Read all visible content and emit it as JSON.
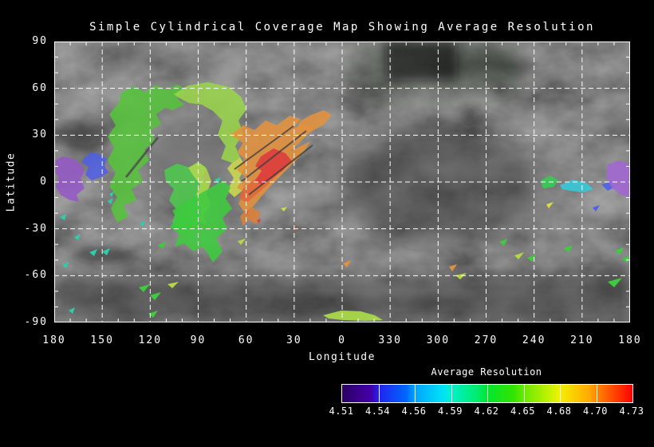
{
  "title": "Simple Cylindrical Coverage Map Showing Average Resolution",
  "map": {
    "x_axis": {
      "label": "Longitude",
      "ticks": [
        "180",
        "150",
        "120",
        "90",
        "60",
        "30",
        "0",
        "330",
        "300",
        "270",
        "240",
        "210",
        "180"
      ]
    },
    "y_axis": {
      "label": "Latitude",
      "ticks": [
        "90",
        "60",
        "30",
        "0",
        "-30",
        "-60",
        "-90"
      ]
    },
    "grid_color": "#ffffff",
    "overlays": [
      {
        "n": "purple-west",
        "c": "#9558c8",
        "o": 0.85,
        "p": "0,150 10,144 22,146 32,152 38,162 33,172 38,184 28,192 31,201 18,198 8,192 2,182 6,170 0,164"
      },
      {
        "n": "blue-west",
        "c": "#4f5fe8",
        "o": 0.85,
        "p": "37,146 46,139 57,141 66,147 63,156 68,164 58,170 47,174 39,167 43,157 35,152"
      },
      {
        "n": "green-band-west",
        "c": "#56c33c",
        "o": 0.88,
        "p": "84,64 100,56 113,63 127,55 141,60 155,54 165,61 154,71 163,79 148,86 139,83 128,91 134,103 121,111 127,125 113,135 119,149 105,161 111,175 97,185 103,199 87,205 93,219 79,227 71,209 79,195 69,181 77,165 67,149 75,133 67,119 77,105 69,91 81,77"
      },
      {
        "n": "green-lobe-lower",
        "c": "#4ec94e",
        "o": 0.88,
        "p": "138,161 154,153 170,158 179,151 190,157 186,171 194,183 184,197 190,211 178,223 184,235 168,231 172,243 156,239 148,225 154,211 144,199 150,185 140,175"
      },
      {
        "n": "yellow-edge-lobe",
        "c": "#b8d84e",
        "o": 0.8,
        "p": "168,158 181,151 191,159 197,175 191,191 197,205 187,217 191,229 179,225 185,209 177,195 183,179 175,169"
      },
      {
        "n": "crescent-top",
        "c": "#9ad44c",
        "o": 0.88,
        "p": "150,66 168,55 193,51 219,57 234,69 241,85 231,99 237,115 227,131 233,145 223,152 209,147 215,131 205,117 211,99 199,87 185,79 169,77 157,71"
      },
      {
        "n": "crescent-yellow-limb",
        "c": "#ccd84e",
        "o": 0.88,
        "p": "223,152 233,145 240,157 232,171 238,185 226,195 217,187 225,171 217,159"
      },
      {
        "n": "crescent-green-bottom",
        "c": "#3ecb3e",
        "o": 0.88,
        "p": "148,212 168,198 184,190 198,182 212,174 221,183 215,197 223,209 211,221 217,235 203,247 211,263 199,277 191,263 185,257 175,263 163,253 151,257 157,241 145,233 153,221"
      },
      {
        "n": "orange-main",
        "c": "#e2923e",
        "o": 0.88,
        "p": "221,117 237,105 251,111 265,99 279,105 295,93 309,97 299,109 315,103 325,109 311,123 297,137 309,131 321,125 313,139 299,153 285,167 271,181 259,195 249,207 239,215 231,203 239,189 229,183 239,169 229,161 239,147 229,139 237,127"
      },
      {
        "n": "orange-streak-ne",
        "c": "#e2923e",
        "o": 0.88,
        "p": "304,110 308,100 322,92 338,86 348,92 338,104 320,114"
      },
      {
        "n": "orange-lower",
        "c": "#dd8038",
        "o": 0.88,
        "p": "247,207 259,215 253,229 243,223 237,231 233,219 241,211"
      },
      {
        "n": "orange-red-band",
        "c": "#e0683a",
        "o": 0.88,
        "p": "237,184 255,170 269,158 281,166 267,180 253,192 241,202 231,196"
      },
      {
        "n": "red-streak",
        "c": "#dd3d3d",
        "o": 0.9,
        "p": "259,144 275,134 290,140 298,150 286,162 272,172 260,180 252,174 260,162 252,156"
      },
      {
        "n": "crack-1",
        "c": "#3f3f3f",
        "o": 0.8,
        "t": "line",
        "w": 2,
        "p": "234,176 316,112"
      },
      {
        "n": "crack-2",
        "c": "#3f3f3f",
        "o": 0.8,
        "t": "line",
        "w": 2,
        "p": "244,192 324,130"
      },
      {
        "n": "crack-3",
        "c": "#3f3f3f",
        "o": 0.8,
        "t": "line",
        "w": 2,
        "p": "226,160 300,106"
      },
      {
        "n": "crack-west",
        "c": "#4a4a4a",
        "o": 0.8,
        "t": "line",
        "w": 3,
        "p": "90,170 130,120"
      },
      {
        "n": "south-pole-sliver",
        "c": "#a8d84a",
        "o": 0.95,
        "p": "337,343 360,337 384,338 402,343 412,349 390,350 362,349 344,347"
      },
      {
        "n": "east-green",
        "c": "#35cc55",
        "o": 0.9,
        "p": "610,174 622,168 632,174 626,182 613,184"
      },
      {
        "n": "east-cyan",
        "c": "#38c8d8",
        "o": 0.9,
        "p": "634,180 650,173 667,177 676,185 663,189 647,187 637,185"
      },
      {
        "n": "east-blue",
        "c": "#4f5fe8",
        "o": 0.9,
        "p": "686,179 697,176 703,182 694,187"
      },
      {
        "n": "east-purple",
        "c": "#a266d6",
        "o": 0.85,
        "p": "694,154 709,149 722,154 722,196 709,191 699,183 692,169"
      },
      {
        "n": "speck",
        "c": "#2ccfa8",
        "o": 1,
        "p": "7,220 15,216 13,224"
      },
      {
        "n": "speck",
        "c": "#2ccfa8",
        "o": 1,
        "p": "25,245 33,241 30,249"
      },
      {
        "n": "speck",
        "c": "#2ccfa8",
        "o": 1,
        "p": "44,264 54,260 50,269"
      },
      {
        "n": "speck",
        "c": "#2ccfa8",
        "o": 1,
        "p": "60,263 70,259 66,268"
      },
      {
        "n": "speck",
        "c": "#2ccfa8",
        "o": 1,
        "p": "10,280 18,276 15,284"
      },
      {
        "n": "speck",
        "c": "#2ccfa8",
        "o": 1,
        "p": "67,200 74,196 71,204"
      },
      {
        "n": "speck",
        "c": "#2ccfa8",
        "o": 1,
        "p": "107,228 114,224 111,232"
      },
      {
        "n": "speck",
        "c": "#2ccfa8",
        "o": 1,
        "p": "69,191 75,188 72,195"
      },
      {
        "n": "speck",
        "c": "#2ccfa8",
        "o": 1,
        "p": "18,337 26,333 23,341"
      },
      {
        "n": "speck",
        "c": "#2ccfa8",
        "o": 1,
        "p": "201,173 209,170 205,178"
      },
      {
        "n": "speck",
        "c": "#3ecb3e",
        "o": 1,
        "p": "130,255 140,251 136,260"
      },
      {
        "n": "speck",
        "c": "#3ecb3e",
        "o": 1,
        "p": "106,308 120,304 112,314"
      },
      {
        "n": "speck",
        "c": "#3ecb3e",
        "o": 1,
        "p": "120,318 134,314 126,324"
      },
      {
        "n": "speck",
        "c": "#3ecb3e",
        "o": 1,
        "p": "118,341 130,337 124,346"
      },
      {
        "n": "speck",
        "c": "#3ecb3e",
        "o": 1,
        "p": "558,251 568,247 564,256"
      },
      {
        "n": "speck",
        "c": "#3ecb3e",
        "o": 1,
        "p": "593,271 604,267 599,276"
      },
      {
        "n": "speck",
        "c": "#3ecb3e",
        "o": 1,
        "p": "638,259 650,255 645,264"
      },
      {
        "n": "speck",
        "c": "#3ecb3e",
        "o": 1,
        "p": "703,262 714,258 709,267"
      },
      {
        "n": "speck",
        "c": "#3ecb3e",
        "o": 1,
        "p": "712,272 722,268 718,277"
      },
      {
        "n": "speck",
        "c": "#3ecb3e",
        "o": 1,
        "p": "694,301 712,296 702,308"
      },
      {
        "n": "speck",
        "c": "#b4d843",
        "o": 1,
        "p": "142,304 156,301 148,309"
      },
      {
        "n": "speck",
        "c": "#b4d843",
        "o": 1,
        "p": "230,250 240,247 234,255"
      },
      {
        "n": "speck",
        "c": "#b4d843",
        "o": 1,
        "p": "503,293 517,290 509,298"
      },
      {
        "n": "speck",
        "c": "#b4d843",
        "o": 1,
        "p": "577,268 589,264 582,273"
      },
      {
        "n": "speck",
        "c": "#d8e040",
        "o": 1,
        "p": "617,204 626,201 620,209"
      },
      {
        "n": "speck",
        "c": "#cbdb4a",
        "o": 1,
        "p": "284,209 292,207 288,213"
      },
      {
        "n": "speck",
        "c": "#4f5fe8",
        "o": 1,
        "p": "675,208 684,205 679,213"
      },
      {
        "n": "speck",
        "c": "#e09040",
        "o": 1,
        "p": "495,282 505,279 499,288"
      },
      {
        "n": "speck",
        "c": "#e09040",
        "o": 1,
        "p": "362,278 372,274 367,283"
      },
      {
        "n": "speck",
        "c": "#e06030",
        "o": 1,
        "p": "239,214 244,212 242,218"
      },
      {
        "n": "speck",
        "c": "#d84040",
        "o": 1,
        "p": "254,224 259,222 257,228"
      },
      {
        "n": "speck",
        "c": "#d84040",
        "o": 1,
        "p": "300,234 305,232 303,238"
      }
    ]
  },
  "colorbar": {
    "title": "Average Resolution",
    "tick_labels": [
      "4.51",
      "4.54",
      "4.56",
      "4.59",
      "4.62",
      "4.65",
      "4.68",
      "4.70",
      "4.73"
    ],
    "segments": 8,
    "gradient_stops": [
      {
        "p": 0,
        "c": "#2c0060"
      },
      {
        "p": 10,
        "c": "#4400aa"
      },
      {
        "p": 12.5,
        "c": "#2222ee"
      },
      {
        "p": 22,
        "c": "#0066ff"
      },
      {
        "p": 25,
        "c": "#00a4ff"
      },
      {
        "p": 35,
        "c": "#00e4f4"
      },
      {
        "p": 37.5,
        "c": "#00f0cc"
      },
      {
        "p": 47,
        "c": "#00ec66"
      },
      {
        "p": 50,
        "c": "#00e630"
      },
      {
        "p": 59,
        "c": "#33e400"
      },
      {
        "p": 62.5,
        "c": "#66ea00"
      },
      {
        "p": 72,
        "c": "#ccf200"
      },
      {
        "p": 75,
        "c": "#f4f000"
      },
      {
        "p": 85,
        "c": "#ffaa00"
      },
      {
        "p": 87.5,
        "c": "#ff8800"
      },
      {
        "p": 97,
        "c": "#ff2200"
      },
      {
        "p": 100,
        "c": "#ff0000"
      }
    ]
  },
  "colors": {
    "background": "#000000",
    "text": "#ffffff",
    "grid": "#ffffff"
  },
  "chart_data": {
    "type": "heatmap",
    "title": "Simple Cylindrical Coverage Map Showing Average Resolution",
    "xlabel": "Longitude",
    "ylabel": "Latitude",
    "x_ticks": [
      180,
      150,
      120,
      90,
      60,
      30,
      0,
      330,
      300,
      270,
      240,
      210,
      180
    ],
    "y_ticks": [
      90,
      60,
      30,
      0,
      -30,
      -60,
      -90
    ],
    "x_axis_note": "longitude wraps 180 -> 0 -> 180 across a simple cylindrical projection",
    "grid": "white dashed gridlines every 30 degrees; grayscale planetary basemap",
    "legend_position": "bottom-right colorbar",
    "colorbar": {
      "title": "Average Resolution",
      "ticks": [
        4.51,
        4.54,
        4.56,
        4.59,
        4.62,
        4.65,
        4.68,
        4.7,
        4.73
      ],
      "range": [
        4.51,
        4.73
      ],
      "scale": "rainbow: purple -> blue -> cyan -> green -> yellow -> orange -> red"
    },
    "coverage_regions": [
      {
        "lon_range": [
          180,
          168
        ],
        "lat_range": [
          7,
          -13
        ],
        "avg_resolution": 4.52,
        "color": "purple"
      },
      {
        "lon_range": [
          162,
          148
        ],
        "lat_range": [
          12,
          -2
        ],
        "avg_resolution": 4.55,
        "color": "blue"
      },
      {
        "lon_range": [
          148,
          110
        ],
        "lat_range": [
          48,
          -25
        ],
        "avg_resolution": 4.62,
        "color": "green band with yellow-green edges"
      },
      {
        "lon_range": [
          112,
          58
        ],
        "lat_range": [
          52,
          -25
        ],
        "avg_resolution": 4.64,
        "color": "yellow-green crescent, bright green at its southern end"
      },
      {
        "lon_range": [
          70,
          8
        ],
        "lat_range": [
          38,
          -18
        ],
        "avg_resolution": 4.69,
        "color": "orange streaked mass"
      },
      {
        "lon_range": [
          52,
          22
        ],
        "lat_range": [
          18,
          -5
        ],
        "avg_resolution": 4.72,
        "color": "red streak"
      },
      {
        "lon_range": [
          252,
          247
        ],
        "lat_range": [
          3,
          -4
        ],
        "avg_resolution": 4.61,
        "color": "green"
      },
      {
        "lon_range": [
          247,
          237
        ],
        "lat_range": [
          2,
          -6
        ],
        "avg_resolution": 4.58,
        "color": "cyan"
      },
      {
        "lon_range": [
          214,
          195
        ],
        "lat_range": [
          10,
          -12
        ],
        "avg_resolution": 4.52,
        "color": "purple (east edge)"
      },
      {
        "lon_range": [
          15,
          340
        ],
        "lat_range": [
          -86,
          -90
        ],
        "avg_resolution": 4.65,
        "color": "yellow-green sliver near south pole"
      },
      {
        "note": "numerous small teal/green/yellow-green specks scattered between lat -20 and -65 on both hemispheres"
      }
    ]
  }
}
